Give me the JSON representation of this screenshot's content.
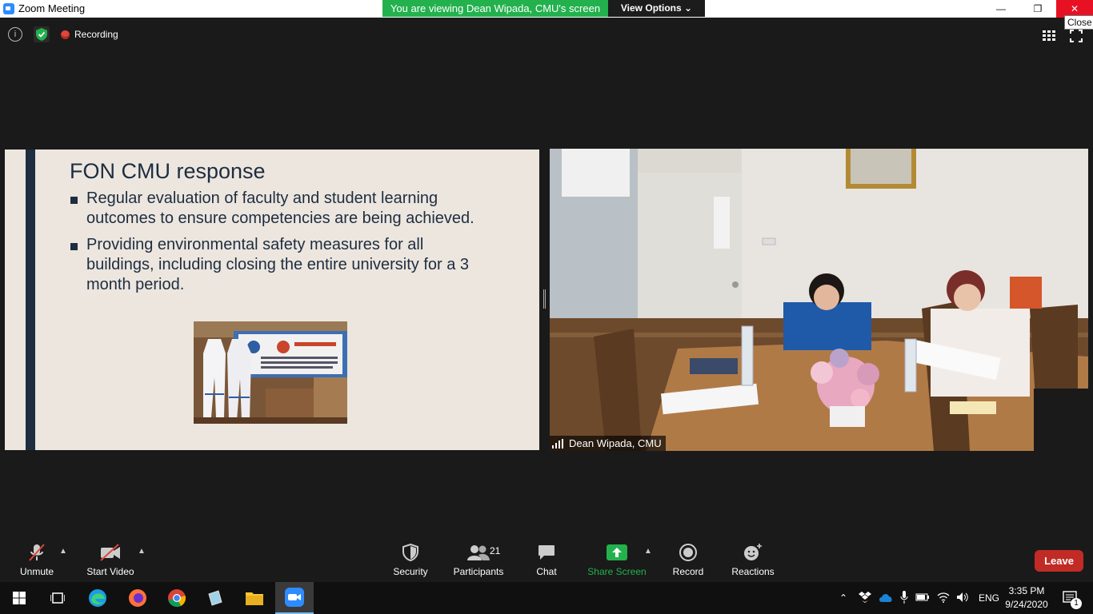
{
  "window": {
    "title": "Zoom Meeting",
    "close_tooltip": "Close"
  },
  "share_banner": {
    "text": "You are viewing Dean Wipada, CMU's screen",
    "view_options_label": "View Options",
    "color": "#23b14d"
  },
  "status_bar": {
    "recording_label": "Recording"
  },
  "slide": {
    "title": "FON CMU response",
    "bullets": [
      "Regular evaluation of faculty and student learning outcomes to ensure competencies are being achieved.",
      "Providing environmental safety measures for all buildings, including closing the entire university for a 3 month period."
    ]
  },
  "video": {
    "participant_name": "Dean Wipada, CMU"
  },
  "toolbar": {
    "unmute_label": "Unmute",
    "start_video_label": "Start Video",
    "security_label": "Security",
    "participants_label": "Participants",
    "participants_count": "21",
    "chat_label": "Chat",
    "share_screen_label": "Share Screen",
    "record_label": "Record",
    "reactions_label": "Reactions",
    "leave_label": "Leave",
    "leave_color": "#c12b26",
    "share_color": "#23b14d"
  },
  "taskbar": {
    "language": "ENG",
    "time": "3:35 PM",
    "date": "9/24/2020",
    "notification_count": "1",
    "apps": [
      "start-icon",
      "task-view-icon",
      "edge-icon",
      "firefox-icon",
      "chrome-icon",
      "notepad-icon",
      "file-explorer-icon",
      "zoom-icon"
    ]
  }
}
